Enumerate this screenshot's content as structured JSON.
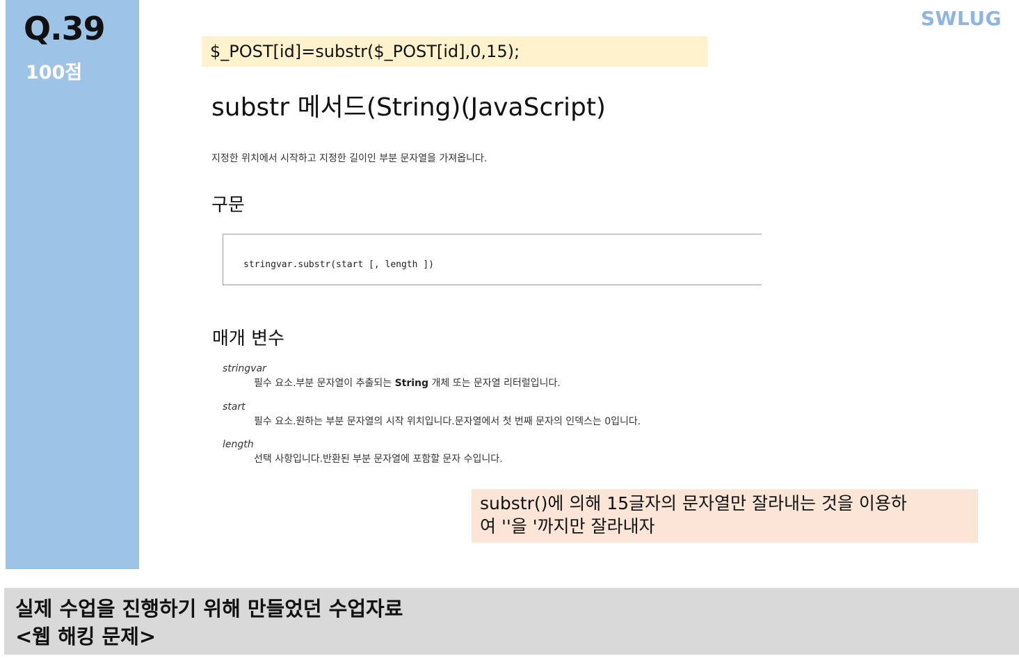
{
  "slide": {
    "question": "Q.39",
    "score": "100점",
    "brand": "SWLUG",
    "code_line": "$_POST[id]=substr($_POST[id],0,15);",
    "note": "substr()에 의해 15글자의 문자열만 잘라내는 것을 이용하\n여 ''을 '까지만 잘라내자",
    "footer_line1": "실제 수업을 진행하기 위해 만들었던 수업자료",
    "footer_line2": "<웹 해킹 문제>"
  },
  "doc": {
    "title": "substr 메서드(String)(JavaScript)",
    "description": "지정한 위치에서 시작하고 지정한 길이인 부분 문자열을 가져옵니다.",
    "syntax_heading": "구문",
    "syntax_code": "stringvar.substr(start [, length ])",
    "params_heading": "매개 변수",
    "params": [
      {
        "name": "stringvar",
        "desc_before": "필수 요소.부분 문자열이 추출되는 ",
        "desc_bold": "String",
        "desc_after": " 개체 또는 문자열 리터럴입니다."
      },
      {
        "name": "start",
        "desc": "필수 요소.원하는 부분 문자열의 시작 위치입니다.문자열에서 첫 번째 문자의 인덱스는 0입니다."
      },
      {
        "name": "length",
        "desc": "선택 사항입니다.반환된 부분 문자열에 포함할 문자 수입니다."
      }
    ]
  }
}
